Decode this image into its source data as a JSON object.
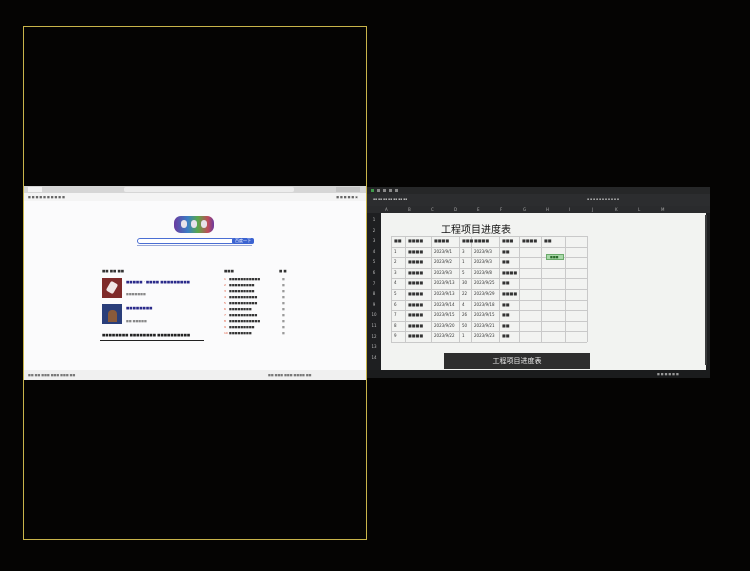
{
  "browser": {
    "nav_text": "■ ■ ■ ■ ■ ■ ■ ■ ■ ■",
    "nav_right": "■ ■ ■ ■ ■ ▣",
    "search_button": "百度一下",
    "news": [
      "■■■■■ ·  ■■■■ ■■■■■■■■■",
      "■■■■■■■",
      "■■■■■■■■",
      "■■ ■■■■■"
    ],
    "hot_items": [
      {
        "n": "1",
        "t": "■■■■■■■■■■■",
        "v": "■"
      },
      {
        "n": "2",
        "t": "■■■■■■■■■",
        "v": "■"
      },
      {
        "n": "3",
        "t": "■■■■■■■■■",
        "v": "■"
      },
      {
        "n": "4",
        "t": "■■■■■■■■■■",
        "v": "■"
      },
      {
        "n": "5",
        "t": "■■■■■■■■■■",
        "v": "■"
      },
      {
        "n": "6",
        "t": "■■■■■■■■",
        "v": "■"
      },
      {
        "n": "7",
        "t": "■■■■■■■■■■",
        "v": "■"
      },
      {
        "n": "8",
        "t": "■■■■■■■■■■■",
        "v": "■"
      },
      {
        "n": "9",
        "t": "■■■■■■■■■",
        "v": "■"
      },
      {
        "n": "10",
        "t": "■■■■■■■■",
        "v": "■"
      }
    ],
    "footer_left": "■■ ■■ ■■■ ■■■ ■■■ ■■",
    "footer_right": "■■ ■■■ ■■■ ■■■■ ■■"
  },
  "excel": {
    "title": "工程项目进度表",
    "caption": "工程项目进度表",
    "columns": [
      "A",
      "B",
      "C",
      "D",
      "E",
      "F",
      "G",
      "H",
      "I",
      "J",
      "K",
      "L",
      "M"
    ],
    "rows": [
      [
        "1",
        "■■■■",
        "2023/9/1",
        "3",
        "2023/9/3",
        "■■",
        ""
      ],
      [
        "2",
        "■■■■",
        "2023/9/2",
        "1",
        "2023/9/3",
        "■■",
        ""
      ],
      [
        "3",
        "■■■■",
        "2023/9/3",
        "5",
        "2023/9/8",
        "■■■■",
        ""
      ],
      [
        "4",
        "■■■■",
        "2023/9/13",
        "30",
        "2023/9/25",
        "■■",
        ""
      ],
      [
        "5",
        "■■■■",
        "2023/9/13",
        "22",
        "2023/9/29",
        "■■■■",
        ""
      ],
      [
        "6",
        "■■■■",
        "2023/9/14",
        "4",
        "2023/9/18",
        "■■",
        ""
      ],
      [
        "7",
        "■■■■",
        "2023/9/15",
        "26",
        "2023/9/15",
        "■■",
        ""
      ],
      [
        "8",
        "■■■■",
        "2023/9/20",
        "50",
        "2023/9/21",
        "■■",
        ""
      ],
      [
        "9",
        "■■■■",
        "2023/9/22",
        "1",
        "2023/9/23",
        "■■",
        ""
      ]
    ],
    "header_row": [
      "■■",
      "■■■■",
      "■■■■",
      "■■■",
      "■■■■",
      "■■■",
      "■■■■",
      "■■"
    ],
    "status_label": "■■■",
    "status_right": "■ ■ ■ ■ ■ ■"
  }
}
